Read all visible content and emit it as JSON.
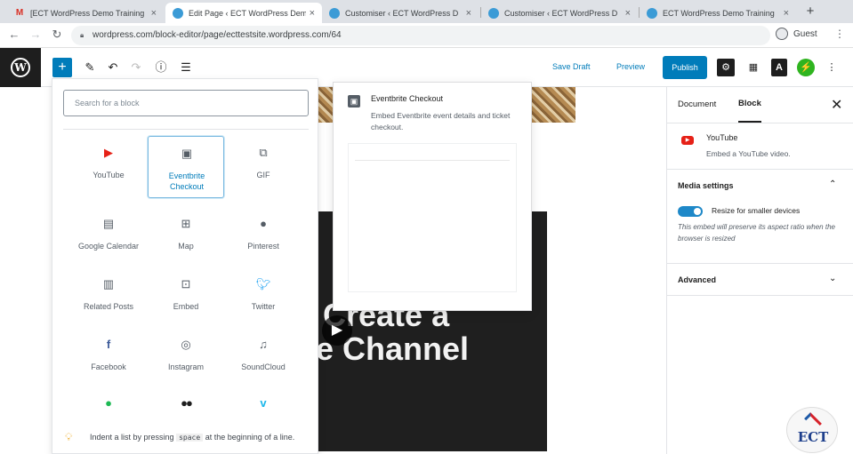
{
  "browser": {
    "tabs": [
      {
        "title": "[ECT WordPress Demo Training",
        "favicon": "gmail-icon",
        "active": false
      },
      {
        "title": "Edit Page ‹ ECT WordPress Dem",
        "favicon": "wordpress-icon",
        "active": true
      },
      {
        "title": "Customiser ‹ ECT WordPress D",
        "favicon": "wordpress-icon",
        "active": false
      },
      {
        "title": "Customiser ‹ ECT WordPress D",
        "favicon": "wordpress-icon",
        "active": false
      },
      {
        "title": "ECT WordPress Demo Training",
        "favicon": "wordpress-icon",
        "active": false
      }
    ],
    "new_tab": "+",
    "url": "wordpress.com/block-editor/page/ecttestsite.wordpress.com/64",
    "profile": "Guest"
  },
  "editor_header": {
    "save_draft": "Save Draft",
    "preview": "Preview",
    "publish": "Publish",
    "block_toolbar_letter": "A"
  },
  "inserter": {
    "search_placeholder": "Search for a block",
    "blocks": [
      {
        "label": "YouTube",
        "icon": "youtube-icon",
        "color": "#e62117"
      },
      {
        "label": "Eventbrite Checkout",
        "icon": "eventbrite-icon",
        "color": "#555d66",
        "selected": true
      },
      {
        "label": "GIF",
        "icon": "gif-icon",
        "color": "#555d66"
      },
      {
        "label": "Google Calendar",
        "icon": "calendar-icon",
        "color": "#555d66"
      },
      {
        "label": "Map",
        "icon": "map-icon",
        "color": "#555d66"
      },
      {
        "label": "Pinterest",
        "icon": "pinterest-icon",
        "color": "#555d66"
      },
      {
        "label": "Related Posts",
        "icon": "related-posts-icon",
        "color": "#555d66"
      },
      {
        "label": "Embed",
        "icon": "embed-icon",
        "color": "#555d66"
      },
      {
        "label": "Twitter",
        "icon": "twitter-icon",
        "color": "#1da1f2"
      },
      {
        "label": "Facebook",
        "icon": "facebook-icon",
        "color": "#3b5998"
      },
      {
        "label": "Instagram",
        "icon": "instagram-icon",
        "color": "#555d66"
      },
      {
        "label": "SoundCloud",
        "icon": "soundcloud-icon",
        "color": "#555d66"
      },
      {
        "label": "",
        "icon": "spotify-icon",
        "color": "#1db954"
      },
      {
        "label": "",
        "icon": "flickr-icon",
        "color": "#1e1e1e"
      },
      {
        "label": "",
        "icon": "vimeo-icon",
        "color": "#1ab7ea"
      }
    ],
    "tip_before": "Indent a list by pressing",
    "tip_key": "space",
    "tip_after": "at the beginning of a line."
  },
  "block_preview": {
    "title": "Eventbrite Checkout",
    "description": "Embed Eventbrite event details and ticket checkout."
  },
  "canvas": {
    "video_text_line1": "Create a",
    "video_text_line2": "e Channel"
  },
  "sidebar": {
    "tab_document": "Document",
    "tab_block": "Block",
    "block_title": "YouTube",
    "block_description": "Embed a YouTube video.",
    "media_settings": "Media settings",
    "resize_label": "Resize for smaller devices",
    "resize_on": true,
    "resize_help": "This embed will preserve its aspect ratio when the browser is resized",
    "advanced": "Advanced"
  },
  "watermark": {
    "text": "ECT"
  }
}
